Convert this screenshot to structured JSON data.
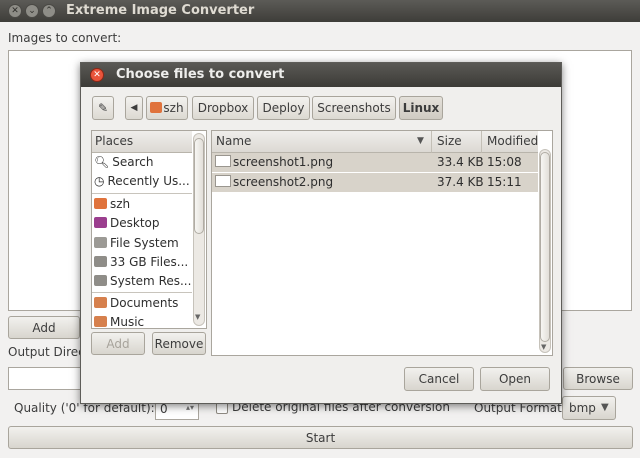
{
  "window": {
    "title": "Extreme Image Converter",
    "images_label": "Images to convert:",
    "add_label": "Add",
    "output_dir_label": "Output Direct",
    "browse_label": "Browse",
    "quality_label": "Quality ('0' for default):",
    "quality_value": "0",
    "delete_label": "Delete original files after conversion",
    "output_format_label": "Output Format:",
    "output_format_value": "bmp",
    "start_label": "Start"
  },
  "dialog": {
    "title": "Choose files to convert",
    "breadcrumbs": [
      "szh",
      "Dropbox",
      "Deploy",
      "Screenshots",
      "Linux"
    ],
    "places_header": "Places",
    "places": [
      {
        "label": "Search",
        "icon": "search-icon"
      },
      {
        "label": "Recently Us...",
        "icon": "recent-icon"
      },
      {
        "label": "szh",
        "icon": "home-folder-icon"
      },
      {
        "label": "Desktop",
        "icon": "desktop-icon"
      },
      {
        "label": "File System",
        "icon": "filesystem-icon"
      },
      {
        "label": "33 GB Files...",
        "icon": "drive-icon"
      },
      {
        "label": "System Res...",
        "icon": "drive-icon"
      },
      {
        "label": "Documents",
        "icon": "documents-folder-icon"
      },
      {
        "label": "Music",
        "icon": "music-folder-icon"
      }
    ],
    "columns": {
      "name": "Name",
      "size": "Size",
      "modified": "Modified"
    },
    "files": [
      {
        "name": "screenshot1.png",
        "size": "33.4 KB",
        "modified": "15:08"
      },
      {
        "name": "screenshot2.png",
        "size": "37.4 KB",
        "modified": "15:11"
      }
    ],
    "add_label": "Add",
    "remove_label": "Remove",
    "cancel_label": "Cancel",
    "open_label": "Open"
  }
}
